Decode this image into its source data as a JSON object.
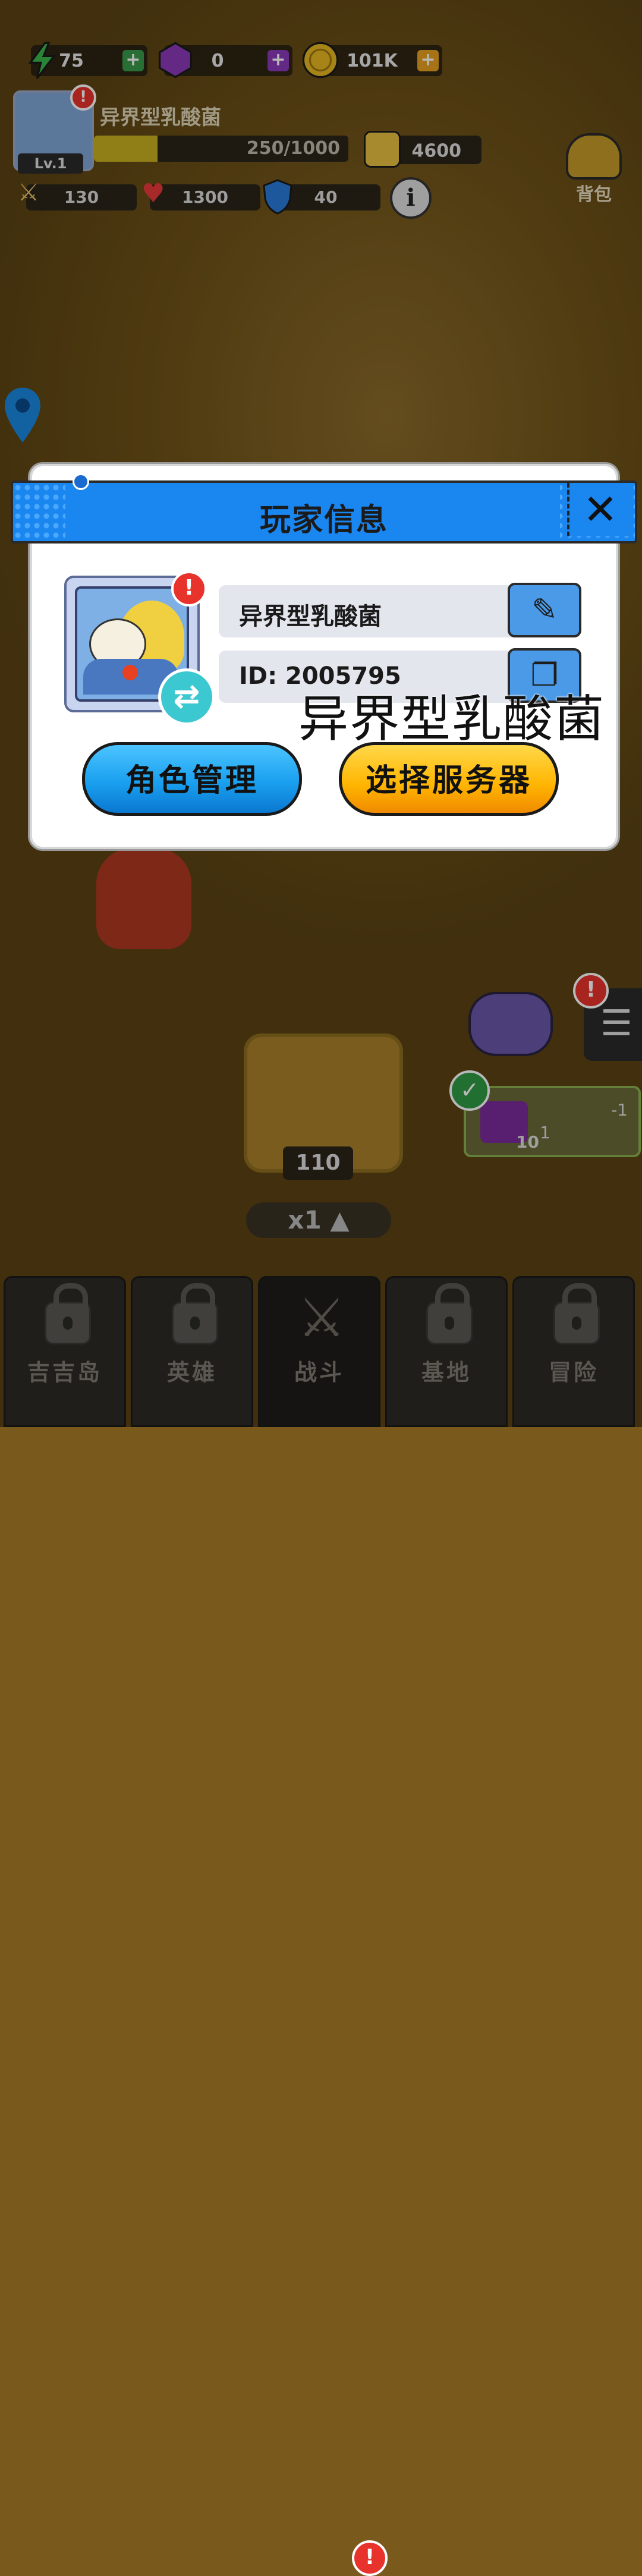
{
  "top_bar": {
    "energy": "75",
    "gems": "0",
    "coins": "101K"
  },
  "player": {
    "name": "异界型乳酸菌",
    "level": "Lv.1",
    "xp_text": "250/1000",
    "xp_progress": 0.25,
    "power": "4600",
    "attack": "130",
    "hp": "1300",
    "defense": "40",
    "alert": "!"
  },
  "bag_label": "背包",
  "info_label": "i",
  "dialog": {
    "title": "玩家信息",
    "close_label": "✕",
    "name_value": "异界型乳酸菌",
    "id_value": "ID: 2005795",
    "overlay_name": "异界型乳酸菌",
    "role_button": "角色管理",
    "server_button": "选择服务器"
  },
  "scene": {
    "box_count": "110",
    "speed_label": "x1",
    "quest_text": "1",
    "quest_count": "10",
    "quest_minus": "-1"
  },
  "nav": {
    "items": [
      {
        "label": "吉吉岛"
      },
      {
        "label": "英雄"
      },
      {
        "label": "战斗"
      },
      {
        "label": "基地"
      },
      {
        "label": "冒险"
      }
    ]
  },
  "colors": {
    "header_blue": "#1a86f0",
    "role_button": "#1aa0f0",
    "server_button": "#ffb400",
    "alert_red": "#e8322c"
  }
}
